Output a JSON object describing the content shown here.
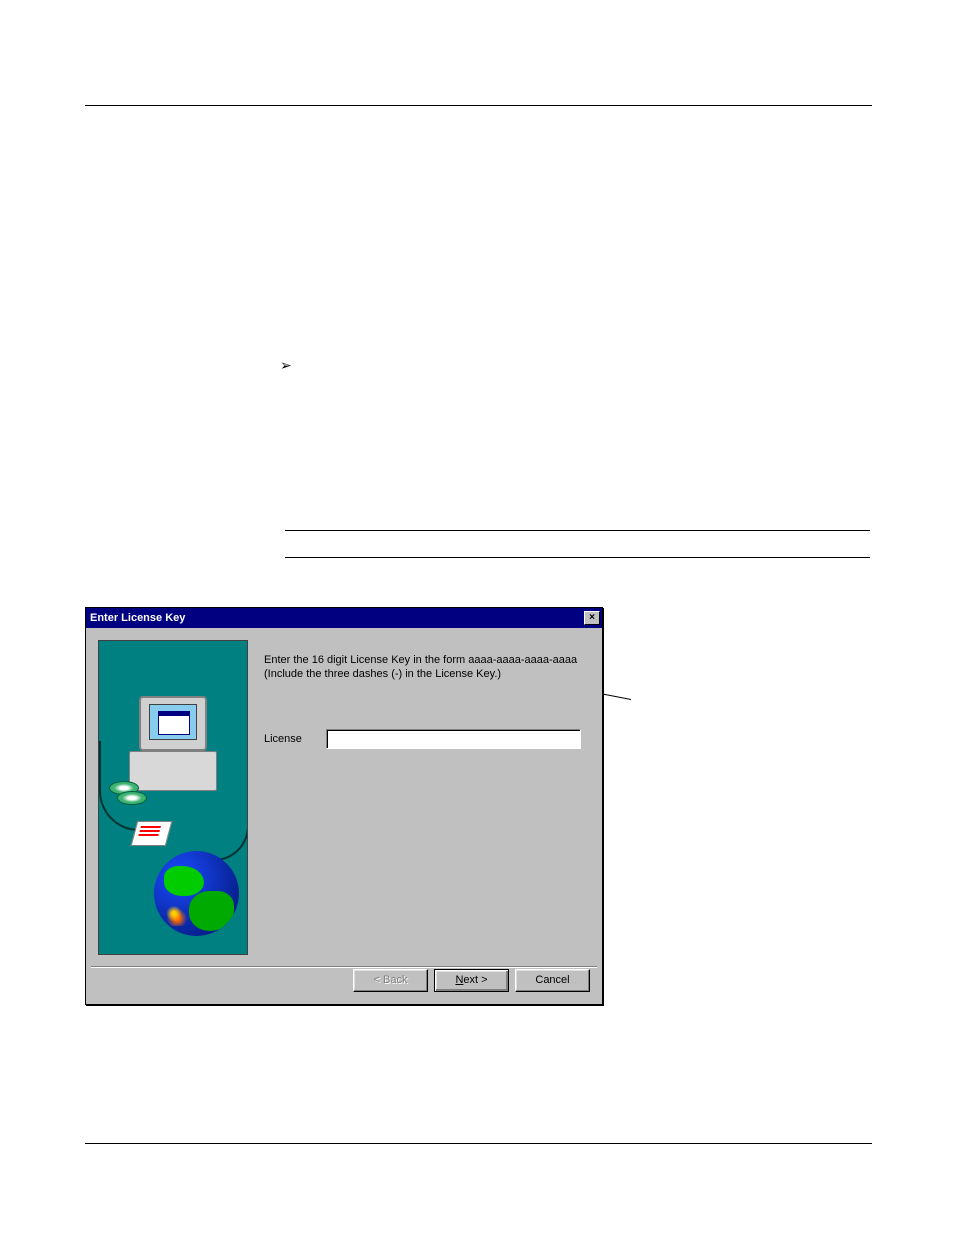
{
  "dialog": {
    "title": "Enter License Key",
    "close_label": "×",
    "instruction_line1": "Enter the 16 digit License Key in the form aaaa-aaaa-aaaa-aaaa",
    "instruction_line2": "(Include the three dashes (-) in the License Key.)",
    "license_label": "License",
    "license_value": "",
    "buttons": {
      "back": "< Back",
      "next_prefix": "N",
      "next_suffix": "ext >",
      "cancel": "Cancel"
    }
  }
}
